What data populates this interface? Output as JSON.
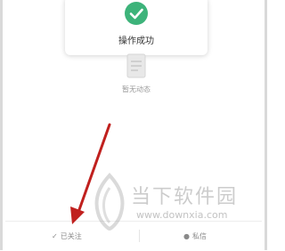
{
  "toast": {
    "text": "操作成功",
    "icon": "check-circle-icon",
    "icon_color": "#3db37a"
  },
  "empty_state": {
    "text": "暂无动态",
    "icon": "document-icon"
  },
  "bottom_bar": {
    "followed_icon": "✓",
    "followed_label": "已关注",
    "message_icon": "●",
    "message_label": "私信"
  },
  "watermark": {
    "title": "当下软件园",
    "url": "www.downxia.com"
  },
  "annotation": {
    "arrow_color": "#c0201e"
  }
}
